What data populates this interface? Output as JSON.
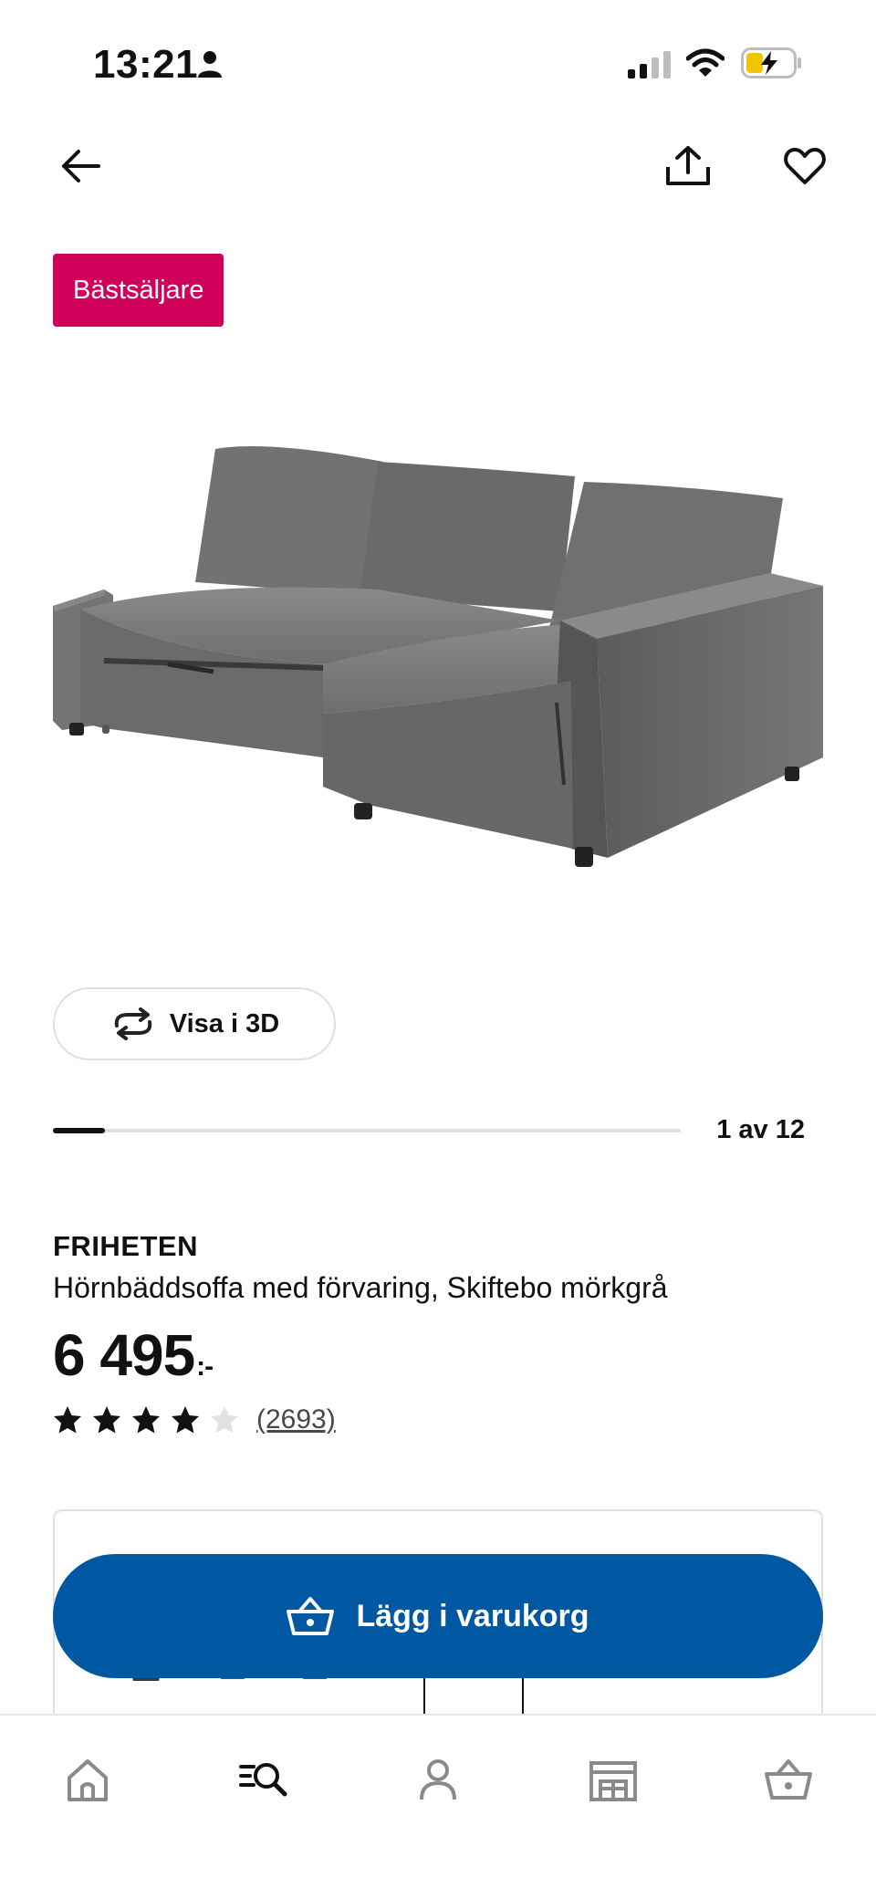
{
  "status_bar": {
    "time": "13:21",
    "icons": [
      "person-icon",
      "signal-icon",
      "wifi-icon",
      "battery-charging-icon"
    ]
  },
  "top_nav": {
    "icons": [
      "back-arrow-icon",
      "share-icon",
      "heart-icon"
    ]
  },
  "badge": {
    "label": "Bästsäljare",
    "color": "#d1005a"
  },
  "gallery": {
    "view_3d_label": "Visa i 3D",
    "view_3d_icon": "rotate-icon",
    "position_label": "1 av 12",
    "current_index": 1,
    "total": 12
  },
  "product": {
    "name": "FRIHETEN",
    "description": "Hörnbäddsoffa med förvaring, Skiftebo mörkgrå",
    "price": "6 495",
    "price_suffix": ":-",
    "rating": 4,
    "rating_max": 5,
    "review_count": "(2693)"
  },
  "cart": {
    "label": "Lägg i varukorg",
    "icon": "basket-icon",
    "color": "#0058a3"
  },
  "bottom_nav": {
    "tabs": [
      {
        "name": "home",
        "icon": "home-icon",
        "active": false
      },
      {
        "name": "search",
        "icon": "search-icon",
        "active": true
      },
      {
        "name": "profile",
        "icon": "person-icon",
        "active": false
      },
      {
        "name": "store",
        "icon": "store-icon",
        "active": false
      },
      {
        "name": "cart",
        "icon": "basket-icon",
        "active": false
      }
    ]
  }
}
